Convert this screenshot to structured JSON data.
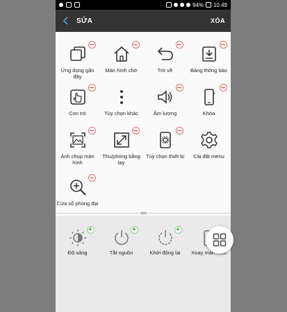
{
  "statusbar": {
    "battery": "94%",
    "time": "10:49"
  },
  "appbar": {
    "title": "SỬA",
    "delete_label": "XÓA"
  },
  "active_items": [
    {
      "label": "Ứng dụng gần đây",
      "icon": "recent-apps-icon"
    },
    {
      "label": "Màn hình chờ",
      "icon": "home-icon"
    },
    {
      "label": "Trở về",
      "icon": "back-arrow-icon"
    },
    {
      "label": "Bảng thông báo",
      "icon": "notification-panel-icon"
    },
    {
      "label": "Con trỏ",
      "icon": "cursor-hand-icon"
    },
    {
      "label": "Tùy chọn khác",
      "icon": "more-options-icon"
    },
    {
      "label": "Âm lượng",
      "icon": "volume-icon"
    },
    {
      "label": "Khóa",
      "icon": "lock-phone-icon"
    },
    {
      "label": "Ảnh chụp màn hình",
      "icon": "screenshot-icon"
    },
    {
      "label": "Thu/phóng bằng tay",
      "icon": "zoom-hand-icon"
    },
    {
      "label": "Tùy chọn thiết bị",
      "icon": "device-options-icon"
    },
    {
      "label": "Cài đặt menu",
      "icon": "gear-icon"
    },
    {
      "label": "Cửa sổ phóng đại",
      "icon": "magnifier-icon"
    }
  ],
  "available_items": [
    {
      "label": "Độ sáng",
      "icon": "brightness-icon"
    },
    {
      "label": "Tắt nguồn",
      "icon": "power-icon"
    },
    {
      "label": "Khởi động lại",
      "icon": "restart-icon"
    },
    {
      "label": "Xoay màn hình",
      "icon": "rotate-screen-icon"
    }
  ],
  "colors": {
    "appbar": "#333333",
    "back_arrow": "#4aa3df",
    "remove_badge": "#d33a3a",
    "add_badge": "#3a9a3a"
  }
}
